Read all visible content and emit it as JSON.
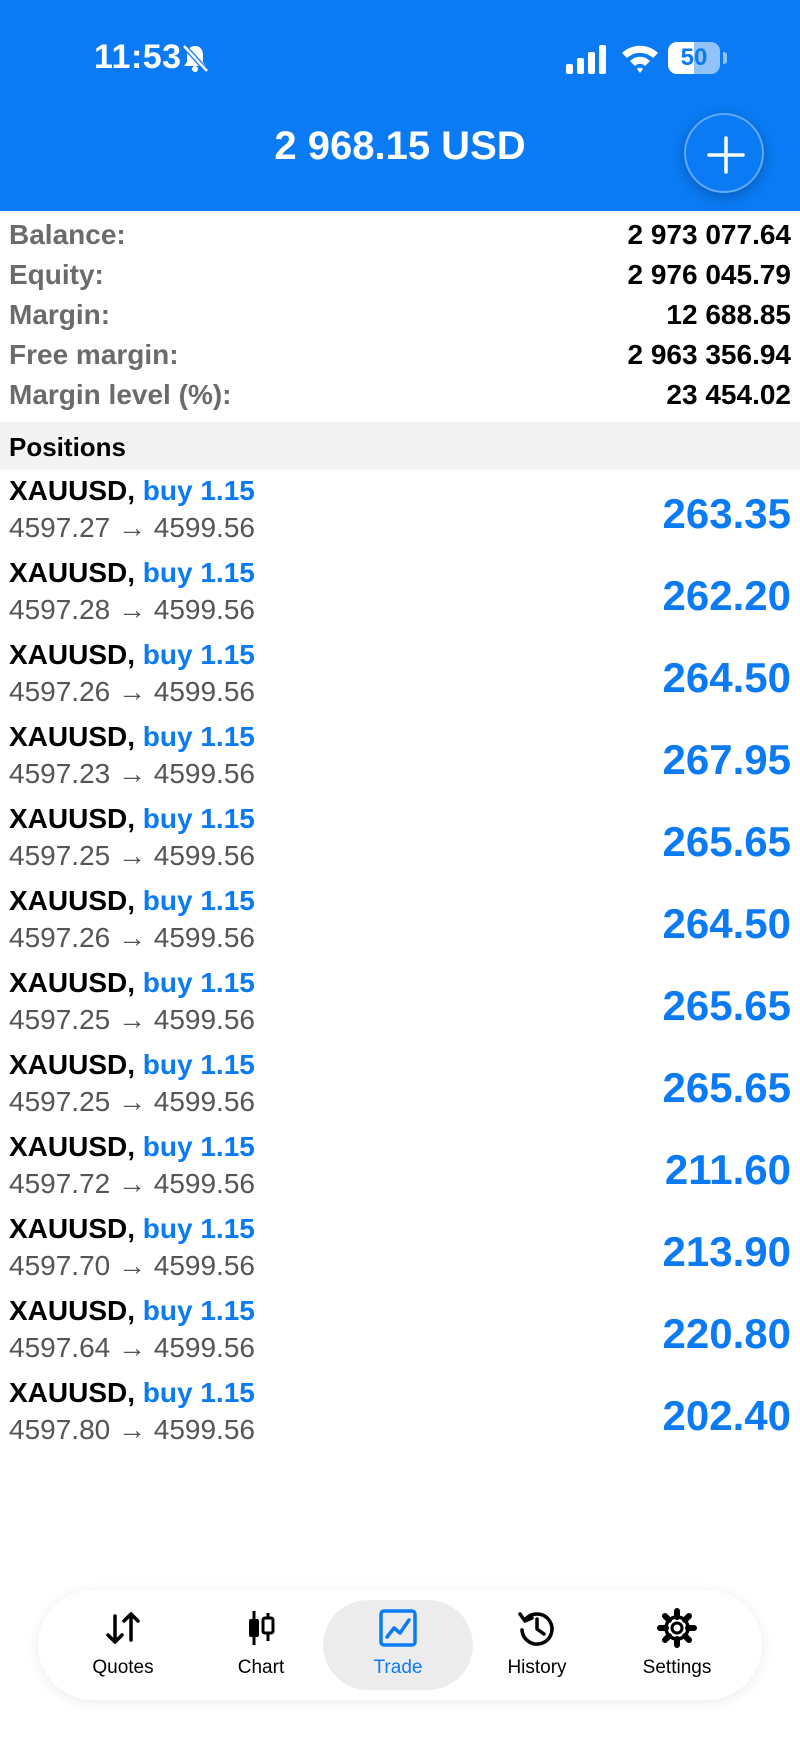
{
  "status_bar": {
    "time": "11:53",
    "battery_level": "50"
  },
  "header": {
    "title": "2 968.15 USD"
  },
  "summary": [
    {
      "label": "Balance:",
      "value": "2 973 077.64"
    },
    {
      "label": "Equity:",
      "value": "2 976 045.79"
    },
    {
      "label": "Margin:",
      "value": "12 688.85"
    },
    {
      "label": "Free margin:",
      "value": "2 963 356.94"
    },
    {
      "label": "Margin level (%):",
      "value": "23 454.02"
    }
  ],
  "positions_title": "Positions",
  "positions": [
    {
      "symbol": "XAUUSD,",
      "type": "buy 1.15",
      "prices": "4597.27 → 4599.56",
      "profit": "263.35"
    },
    {
      "symbol": "XAUUSD,",
      "type": "buy 1.15",
      "prices": "4597.28 → 4599.56",
      "profit": "262.20"
    },
    {
      "symbol": "XAUUSD,",
      "type": "buy 1.15",
      "prices": "4597.26 → 4599.56",
      "profit": "264.50"
    },
    {
      "symbol": "XAUUSD,",
      "type": "buy 1.15",
      "prices": "4597.23 → 4599.56",
      "profit": "267.95"
    },
    {
      "symbol": "XAUUSD,",
      "type": "buy 1.15",
      "prices": "4597.25 → 4599.56",
      "profit": "265.65"
    },
    {
      "symbol": "XAUUSD,",
      "type": "buy 1.15",
      "prices": "4597.26 → 4599.56",
      "profit": "264.50"
    },
    {
      "symbol": "XAUUSD,",
      "type": "buy 1.15",
      "prices": "4597.25 → 4599.56",
      "profit": "265.65"
    },
    {
      "symbol": "XAUUSD,",
      "type": "buy 1.15",
      "prices": "4597.25 → 4599.56",
      "profit": "265.65"
    },
    {
      "symbol": "XAUUSD,",
      "type": "buy 1.15",
      "prices": "4597.72 → 4599.56",
      "profit": "211.60"
    },
    {
      "symbol": "XAUUSD,",
      "type": "buy 1.15",
      "prices": "4597.70 → 4599.56",
      "profit": "213.90"
    },
    {
      "symbol": "XAUUSD,",
      "type": "buy 1.15",
      "prices": "4597.64 → 4599.56",
      "profit": "220.80"
    },
    {
      "symbol": "XAUUSD,",
      "type": "buy 1.15",
      "prices": "4597.80 → 4599.56",
      "profit": "202.40"
    }
  ],
  "tabs": [
    {
      "label": "Quotes",
      "icon": "quotes-icon"
    },
    {
      "label": "Chart",
      "icon": "chart-icon"
    },
    {
      "label": "Trade",
      "icon": "trade-icon"
    },
    {
      "label": "History",
      "icon": "history-icon"
    },
    {
      "label": "Settings",
      "icon": "settings-icon"
    }
  ],
  "active_tab": "Trade",
  "colors": {
    "accent": "#0a7bf5",
    "label_gray": "#6b6b6b",
    "section_bg": "#f3f3f3"
  }
}
